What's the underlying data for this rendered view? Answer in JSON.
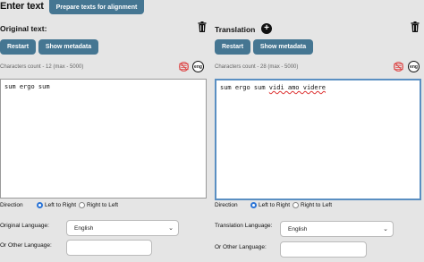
{
  "header": {
    "title": "Enter text",
    "prepare_label": "Prepare texts for alignment"
  },
  "left": {
    "title": "Original text:",
    "restart_label": "Restart",
    "metadata_label": "Show metadata",
    "count": "Characters count - 12 (max - 5000)",
    "lang_badge": "eng",
    "text": "sum ergo sum",
    "direction_label": "Direction",
    "ltr_label": "Left to Right",
    "rtl_label": "Right to Left",
    "direction_selected": "Left to Right",
    "language_label": "Original Language:",
    "language_value": "English",
    "other_language_label": "Or Other Language:",
    "other_language_value": ""
  },
  "right": {
    "title": "Translation",
    "restart_label": "Restart",
    "metadata_label": "Show metadata",
    "count": "Characters count - 28 (max - 5000)",
    "lang_badge": "eng",
    "text_plain": "sum ergo sum ",
    "text_flagged": "vidi amo videre",
    "direction_label": "Direction",
    "ltr_label": "Left to Right",
    "rtl_label": "Right to Left",
    "direction_selected": "Left to Right",
    "language_label": "Translation Language:",
    "language_value": "English",
    "other_language_label": "Or Other Language:",
    "other_language_value": ""
  },
  "icons": {
    "add": "plus-circle-icon",
    "delete": "trash-icon",
    "spellcheck_off": "no-spellcheck-icon",
    "dropdown": "chevron-down-icon"
  },
  "colors": {
    "button": "#457692",
    "focus_border": "#5a8fc2",
    "radio_checked": "#2a74d6",
    "spell_off": "#d33"
  }
}
